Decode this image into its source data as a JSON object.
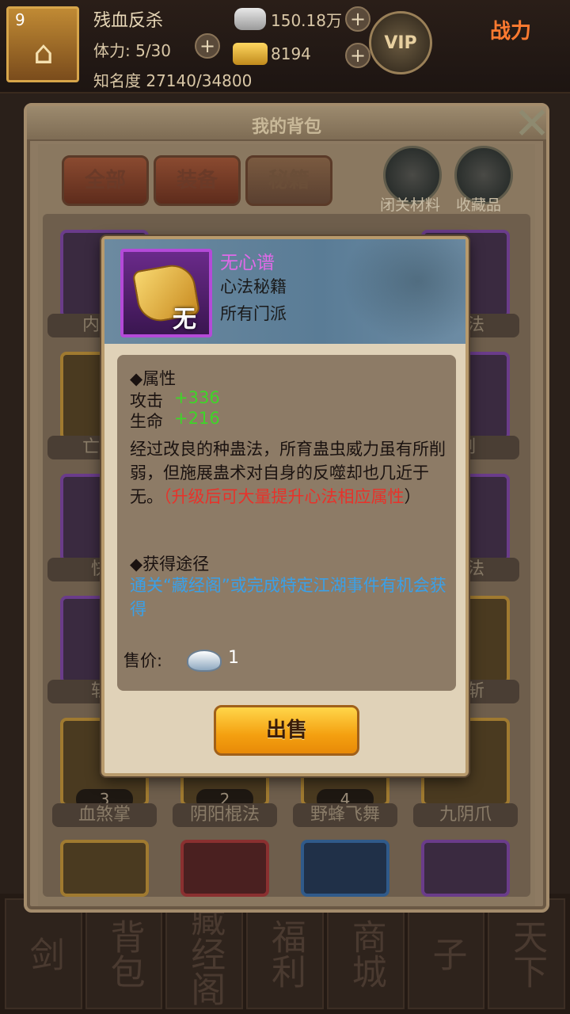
{
  "player": {
    "level": "9",
    "name": "残血反杀",
    "stamina": "体力: 5/30",
    "fame": "知名度 27140/34800",
    "silver": "150.18万",
    "gold": "8194",
    "vip": "VIP",
    "power_label": "战力"
  },
  "bag": {
    "title": "我的背包",
    "tabs": [
      {
        "label": "全部"
      },
      {
        "label": "装备"
      },
      {
        "label": "秘籍"
      }
    ],
    "shortcuts": [
      {
        "label": "闭关材料"
      },
      {
        "label": "收藏品"
      }
    ],
    "slot_names": {
      "row1_left": "内功",
      "row1_right": "极法",
      "row2_left": "亡命",
      "row2_right": "剑",
      "row3_left": "快",
      "row3_right": "剑法",
      "row4_left": "斩",
      "row4_right": "合斩"
    },
    "bottom_row": [
      {
        "name": "血煞掌",
        "count": "3"
      },
      {
        "name": "阴阳棍法",
        "count": "2"
      },
      {
        "name": "野蜂飞舞",
        "count": "4"
      },
      {
        "name": "九阴爪",
        "count": ""
      }
    ]
  },
  "tooltip": {
    "icon_glyph": "无",
    "name": "无心谱",
    "type": "心法秘籍",
    "school": "所有门派",
    "attr_header": "◆属性",
    "stats": [
      {
        "label": "攻击",
        "value": "+336"
      },
      {
        "label": "生命",
        "value": "+216"
      }
    ],
    "description": "经过改良的种蛊法，所育蛊虫威力虽有所削弱，但施展蛊术对自身的反噬却也几近于无。",
    "description_open": "（",
    "description_highlight": "升级后可大量提升心法相应属性",
    "description_close": "）",
    "source_header": "◆获得途径",
    "source_text": "通关“藏经阁”或完成特定江湖事件有机会获得",
    "price_label": "售价:",
    "price_value": "1",
    "sell_button": "出售"
  },
  "bottom_nav": [
    {
      "label": "剑"
    },
    {
      "label": "背包"
    },
    {
      "label": "藏经阁"
    },
    {
      "label": "福利"
    },
    {
      "label": "商城"
    },
    {
      "label": "子"
    },
    {
      "label": "天下"
    }
  ],
  "colors": {
    "item_name": "#e06ae8",
    "stat_value": "#3ed628",
    "highlight": "#e8322a",
    "source": "#3aa0e8",
    "sell_button": "#f4a010"
  }
}
